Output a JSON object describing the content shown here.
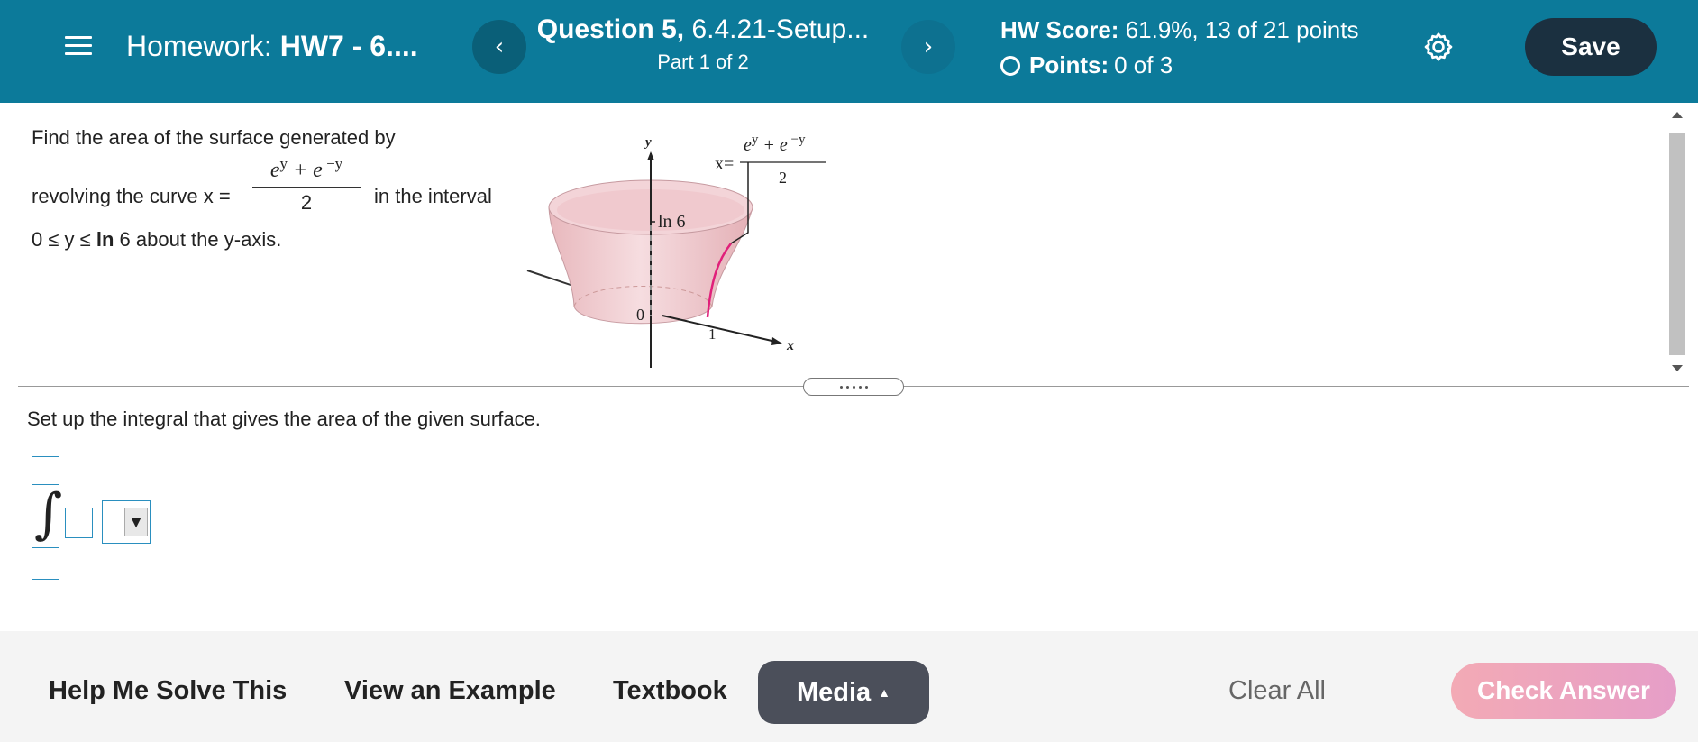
{
  "header": {
    "homework_label": "Homework:",
    "homework_name": "HW7 - 6....",
    "prev_symbol": "‹",
    "next_symbol": "›",
    "question_bold": "Question 5,",
    "question_rest": "6.4.21-Setup...",
    "part": "Part 1 of 2",
    "score_bold": "HW Score:",
    "score_rest": "61.9%, 13 of 21 points",
    "points_bold": "Points:",
    "points_rest": "0 of 3",
    "save_label": "Save"
  },
  "problem": {
    "line1": "Find the area of the surface generated by",
    "line2_prefix": "revolving the curve x =",
    "frac_num_a": "e",
    "frac_num_a_exp": "y",
    "frac_num_plus": " + e",
    "frac_num_b_exp": " −y",
    "frac_den": "2",
    "line2_suffix": "in the interval",
    "line3_a": "0 ≤ y ≤",
    "line3_ln": "ln",
    "line3_b": "6 about the y-axis."
  },
  "figure": {
    "axis_y": "y",
    "axis_x": "x",
    "label_ln6": "ln 6",
    "label_zero": "0",
    "label_one": "1",
    "eq_x": "x=",
    "eq_num": "e",
    "eq_exp1": "y",
    "eq_plus": " + e",
    "eq_exp2": " −y",
    "eq_den": "2"
  },
  "question": {
    "instruction": "Set up the integral that gives the area of the given surface.",
    "integral_symbol": "∫",
    "dropdown_arrow": "▼"
  },
  "footer": {
    "help": "Help Me Solve This",
    "example": "View an Example",
    "textbook": "Textbook",
    "media": "Media",
    "media_caret": "▲",
    "clear_all": "Clear All",
    "check_answer": "Check Answer"
  },
  "colors": {
    "header_bg": "#0c7a9a",
    "save_bg": "#1b3040",
    "media_bg": "#4b4f5a",
    "check_answer": "#f3aab5",
    "input_border": "#2a8fbf",
    "curve": "#e0207a"
  },
  "icons": [
    "menu-icon",
    "chevron-left-icon",
    "chevron-right-icon",
    "circle-icon",
    "gear-icon"
  ]
}
